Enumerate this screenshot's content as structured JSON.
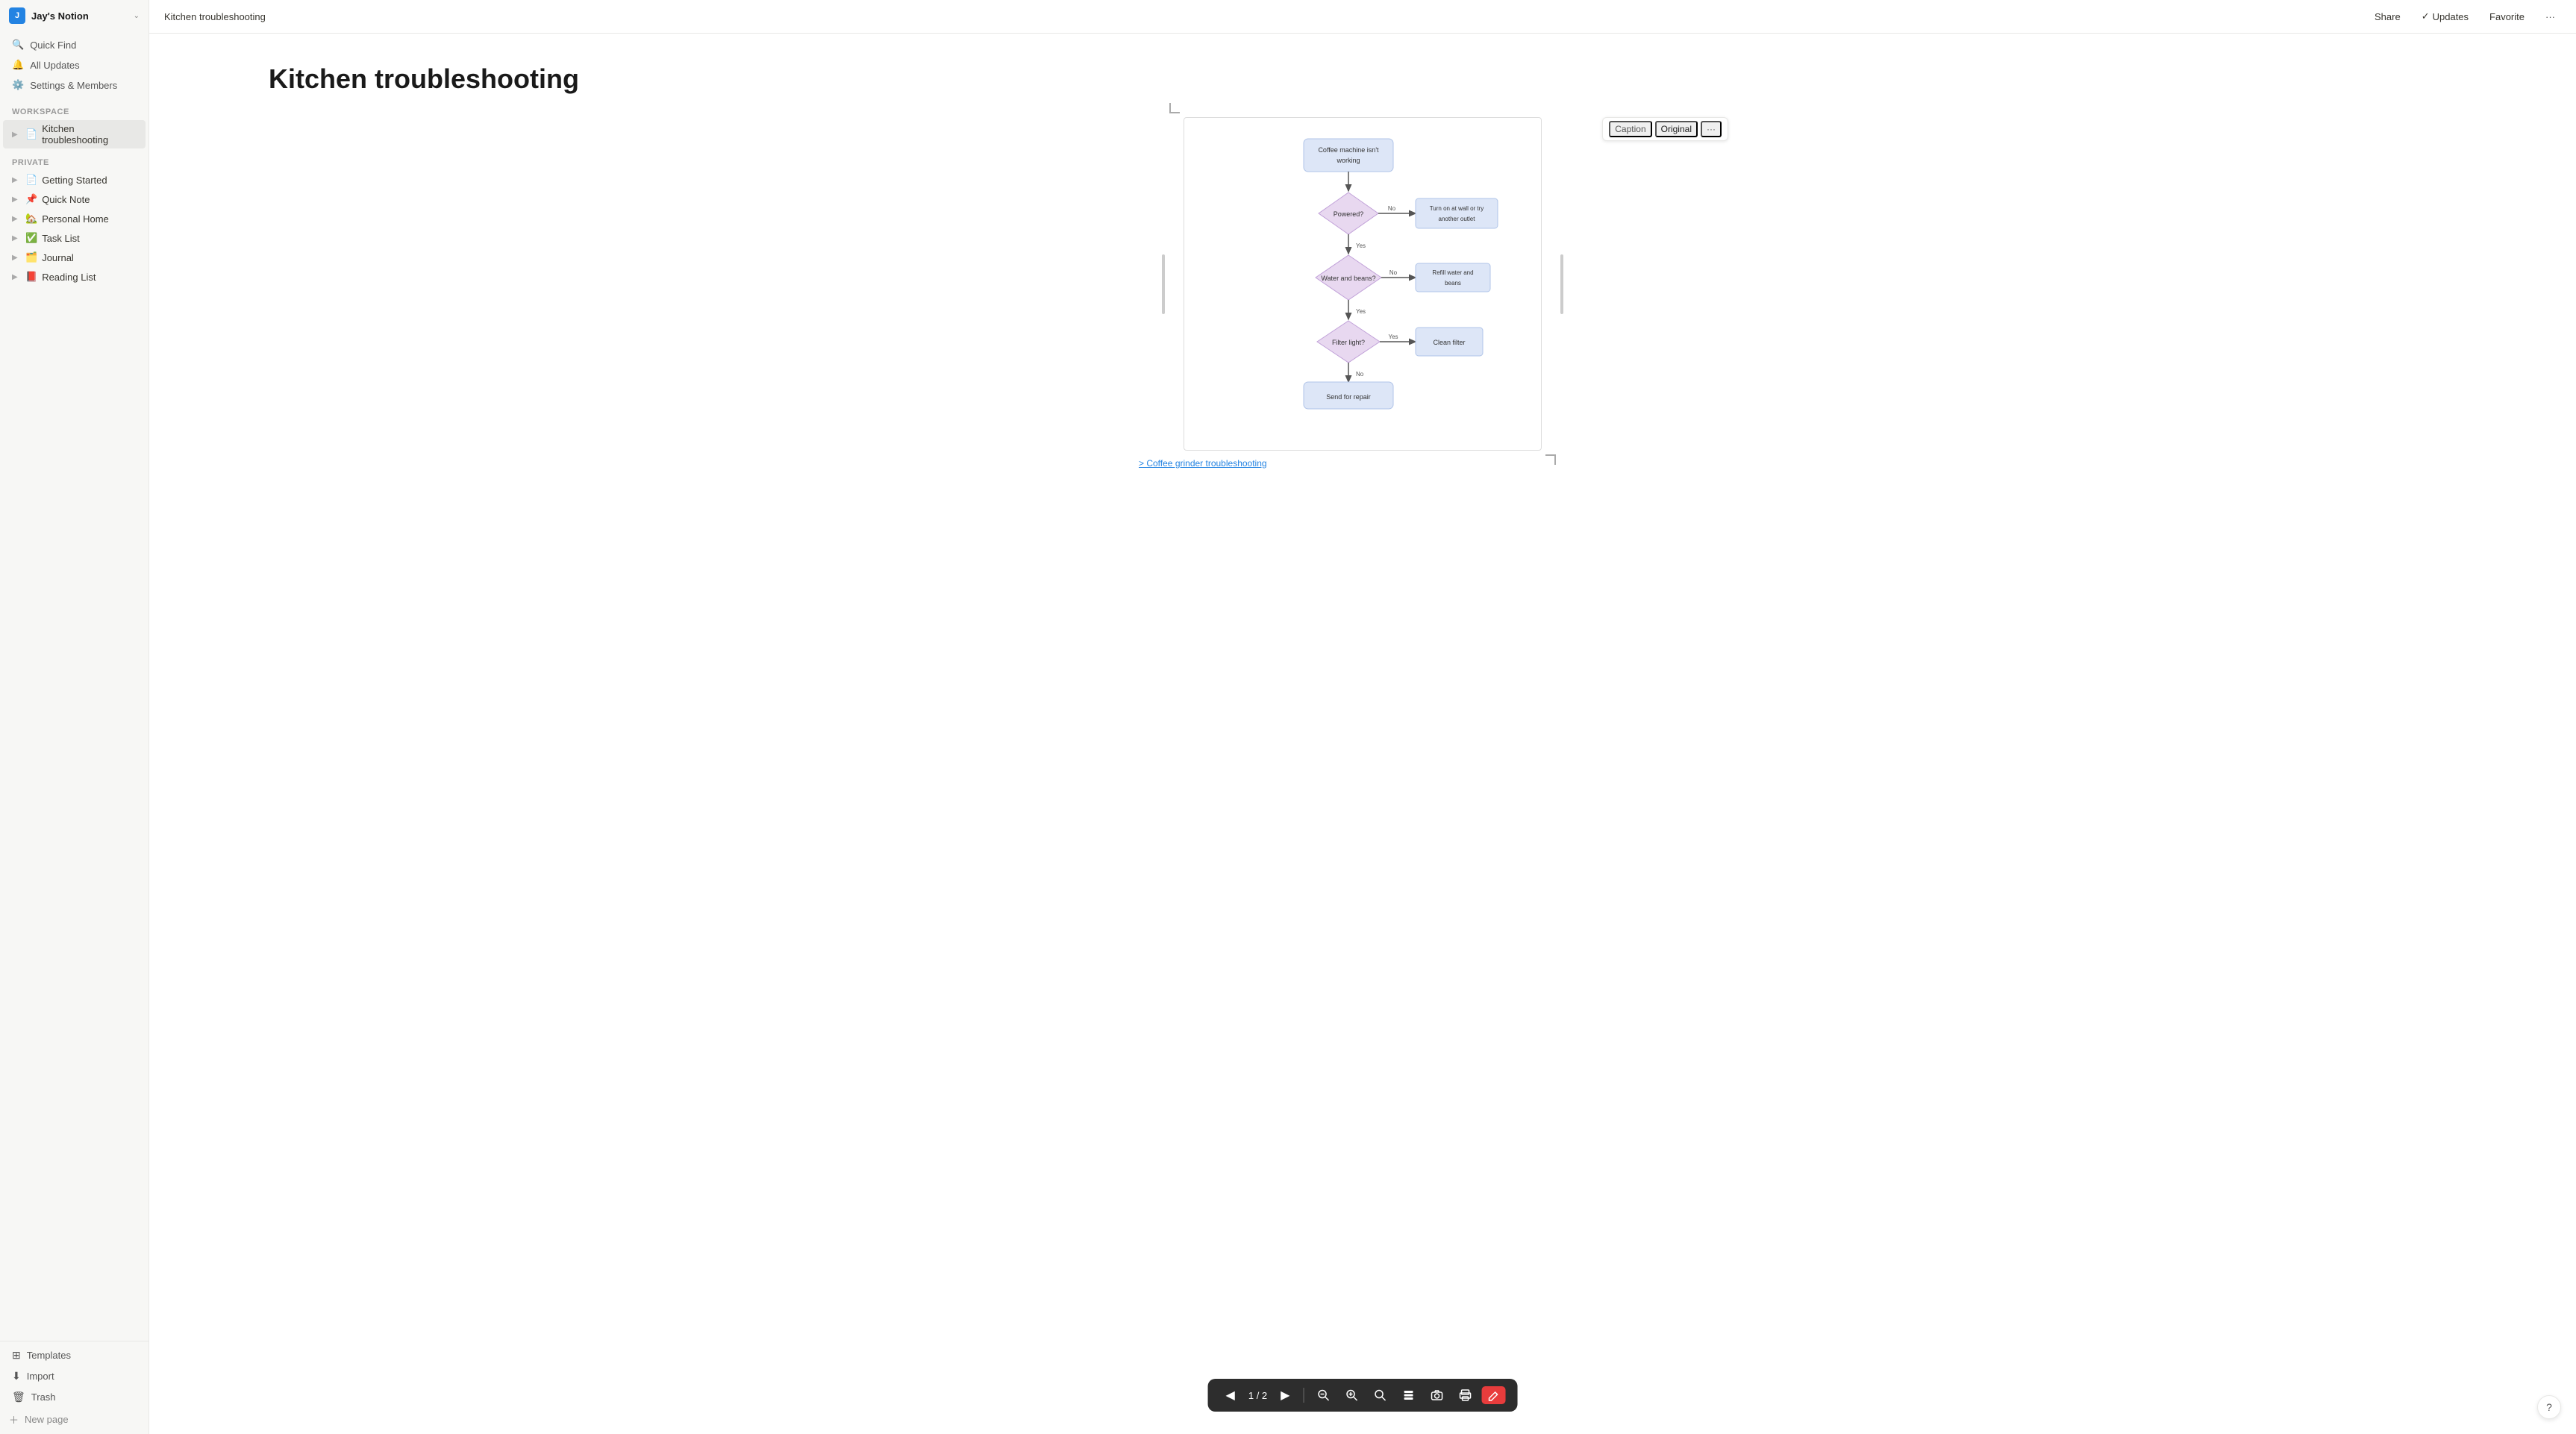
{
  "workspace": {
    "name": "Jay's Notion",
    "avatar_letter": "J"
  },
  "topbar": {
    "title": "Kitchen troubleshooting",
    "share_label": "Share",
    "updates_label": "Updates",
    "favorite_label": "Favorite",
    "more_label": "···"
  },
  "sidebar": {
    "nav_items": [
      {
        "id": "quick-find",
        "icon": "🔍",
        "label": "Quick Find"
      },
      {
        "id": "all-updates",
        "icon": "🔔",
        "label": "All Updates"
      },
      {
        "id": "settings",
        "icon": "⚙️",
        "label": "Settings & Members"
      }
    ],
    "workspace_section": "WORKSPACE",
    "workspace_pages": [
      {
        "id": "kitchen-troubleshooting",
        "icon": "📄",
        "label": "Kitchen troubleshooting",
        "active": true
      }
    ],
    "private_section": "PRIVATE",
    "private_pages": [
      {
        "id": "getting-started",
        "icon": "📄",
        "emoji": "",
        "label": "Getting Started"
      },
      {
        "id": "quick-note",
        "icon": "📌",
        "emoji": "📌",
        "label": "Quick Note"
      },
      {
        "id": "personal-home",
        "icon": "🏡",
        "emoji": "🏡",
        "label": "Personal Home"
      },
      {
        "id": "task-list",
        "icon": "✅",
        "emoji": "✅",
        "label": "Task List"
      },
      {
        "id": "journal",
        "icon": "🗂️",
        "emoji": "🗂️",
        "label": "Journal"
      },
      {
        "id": "reading-list",
        "icon": "📕",
        "emoji": "📕",
        "label": "Reading List"
      }
    ],
    "bottom_items": [
      {
        "id": "templates",
        "icon": "⊞",
        "label": "Templates"
      },
      {
        "id": "import",
        "icon": "⬇",
        "label": "Import"
      },
      {
        "id": "trash",
        "icon": "🗑",
        "label": "Trash"
      }
    ],
    "new_page_label": "+ New page"
  },
  "page": {
    "title": "Kitchen troubleshooting",
    "diagram_toolbar": {
      "caption_label": "Caption",
      "original_label": "Original",
      "more_label": "···"
    },
    "flowchart": {
      "nodes": {
        "start": "Coffee machine isn't working",
        "powered_question": "Powered?",
        "powered_no_action": "Turn on at wall or try another outlet",
        "water_question": "Water and beans?",
        "water_no_action": "Refill water and beans",
        "filter_question": "Filter light?",
        "filter_yes_action": "Clean filter",
        "end": "Send for repair"
      },
      "arrows": {
        "powered_no": "No",
        "powered_yes": "Yes",
        "water_no": "No",
        "water_yes": "Yes",
        "filter_yes": "Yes",
        "filter_no": "No"
      }
    },
    "link_text": "> Coffee grinder troubleshooting",
    "toolbar": {
      "page_indicator": "1 / 2",
      "zoom_out": "−",
      "zoom_in": "+",
      "search": "🔍",
      "layers": "⊞",
      "camera": "📷",
      "print": "🖨",
      "edit": "✏️"
    }
  },
  "help_button": "?"
}
